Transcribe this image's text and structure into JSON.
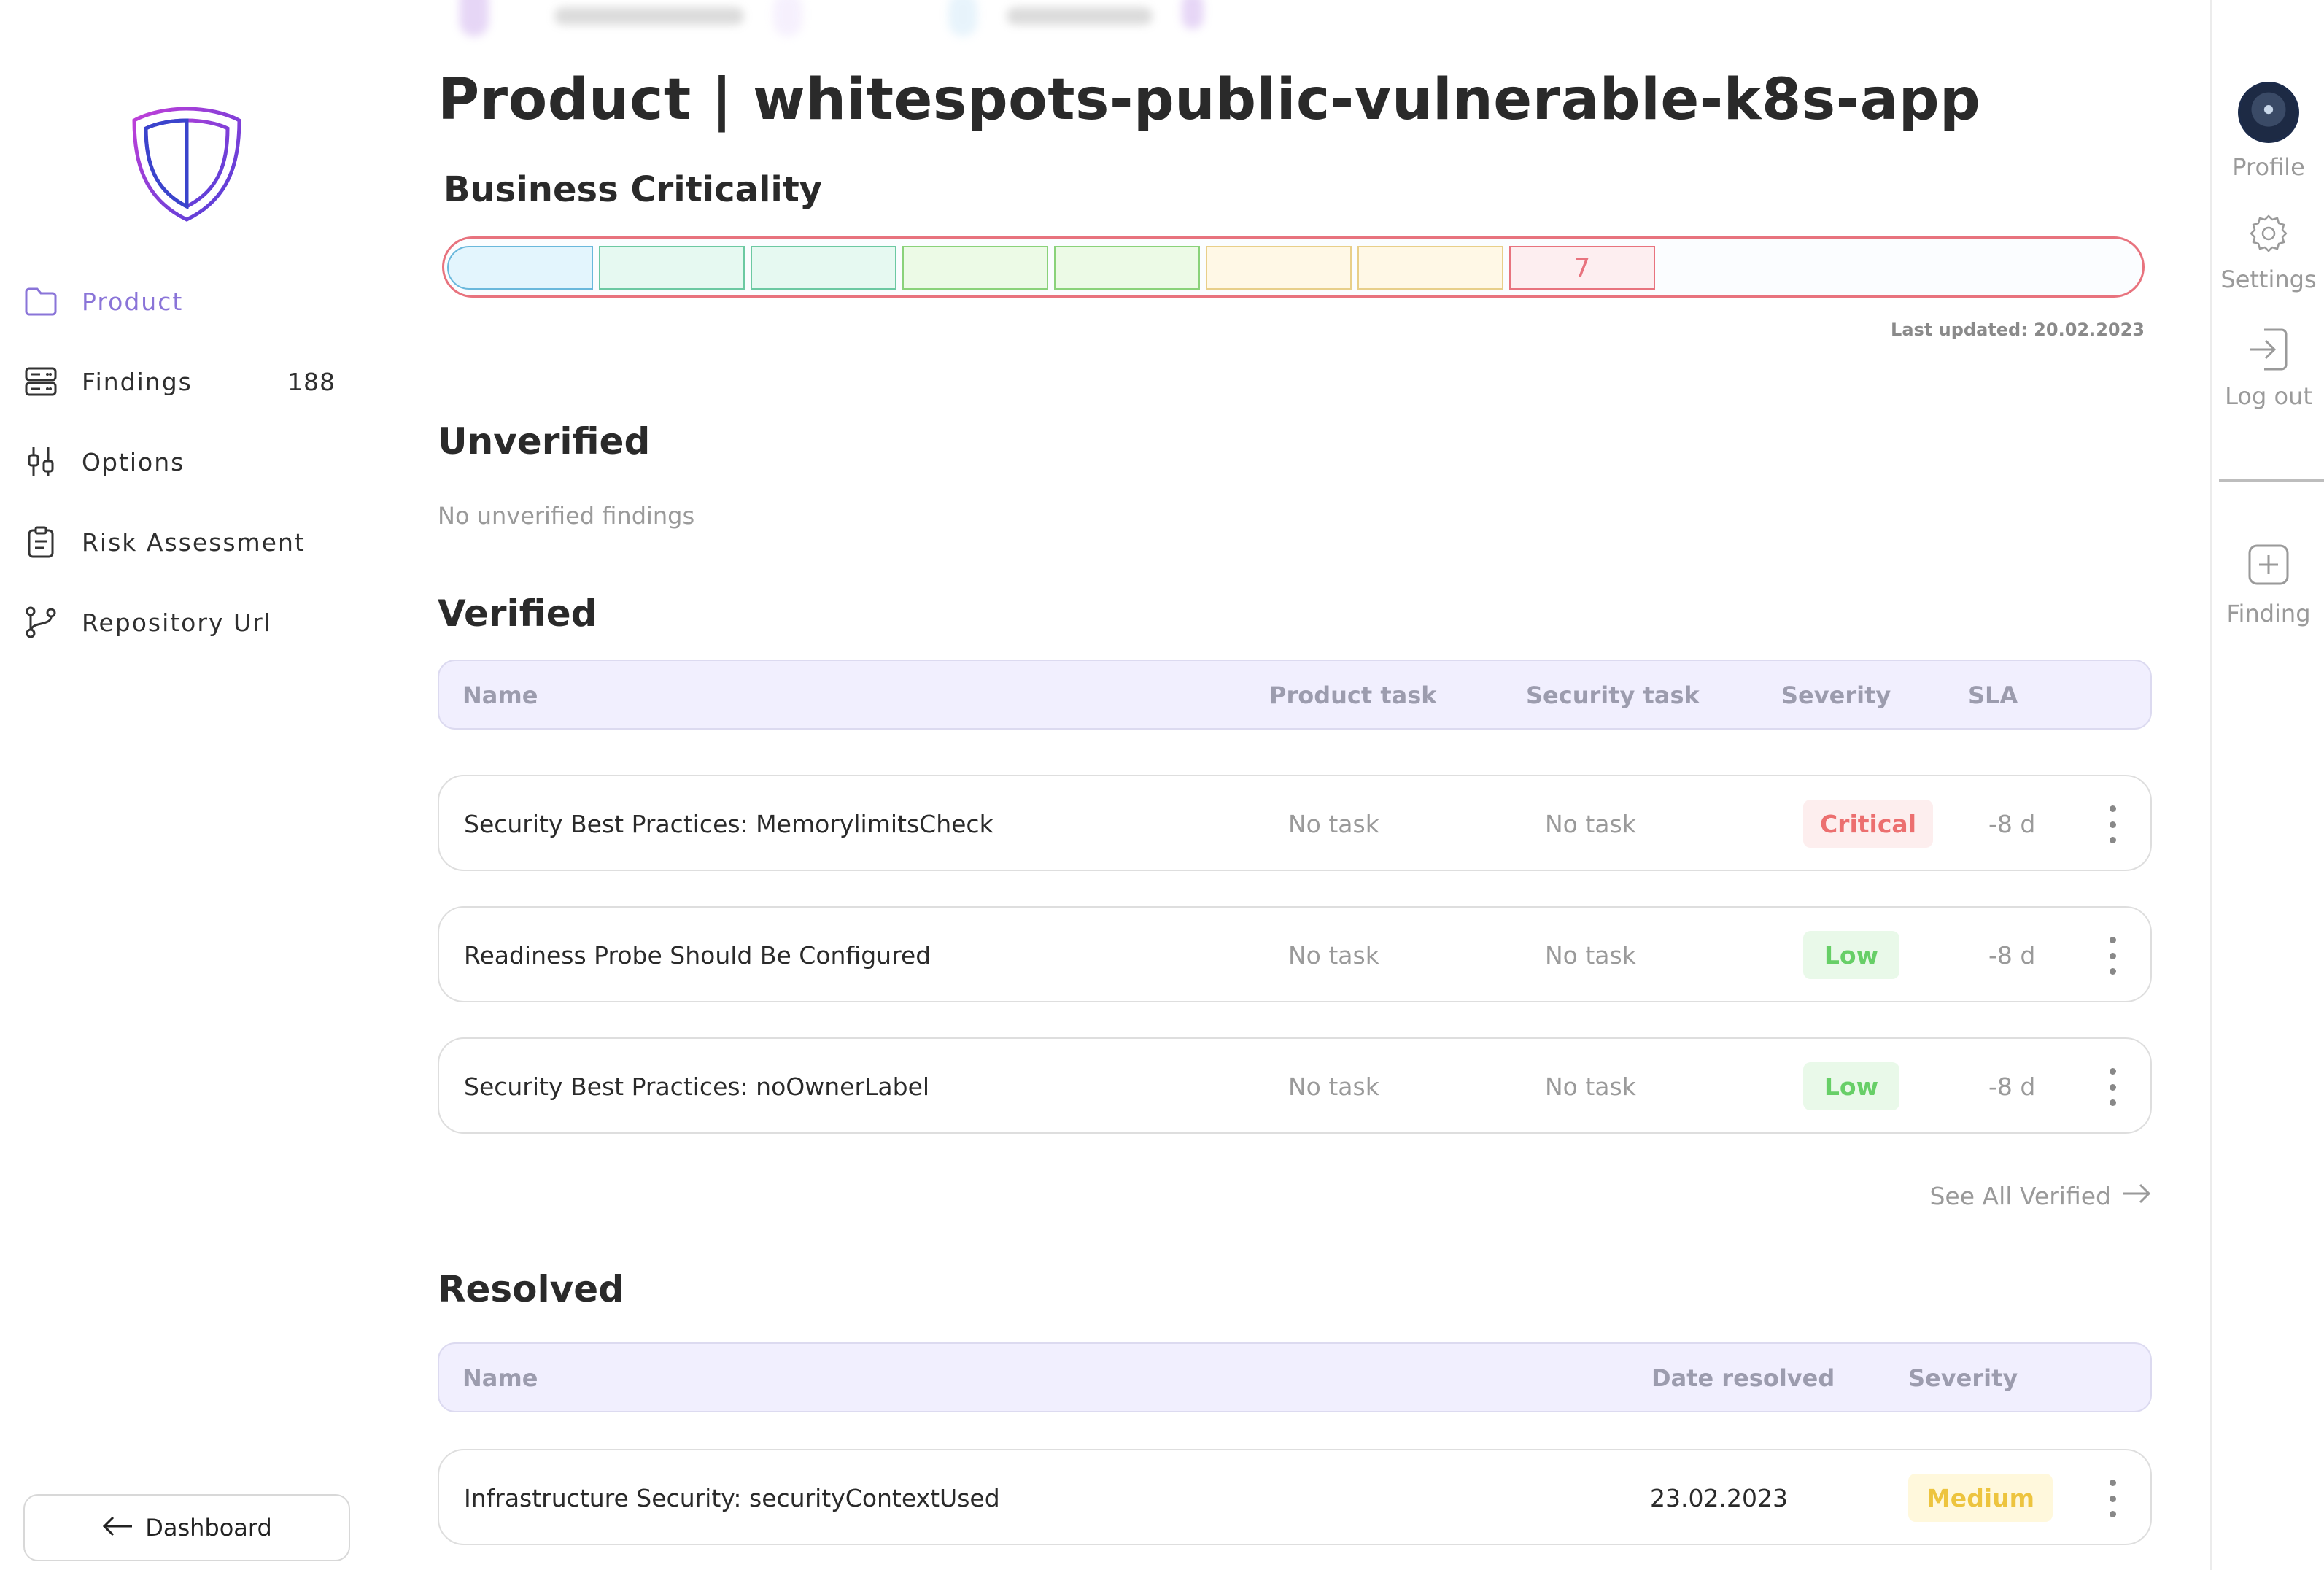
{
  "sidebar": {
    "items": [
      {
        "label": "Product",
        "icon": "folder-icon",
        "active": true
      },
      {
        "label": "Findings",
        "icon": "server-stack-icon",
        "count": "188"
      },
      {
        "label": "Options",
        "icon": "sliders-icon"
      },
      {
        "label": "Risk Assessment",
        "icon": "clipboard-icon"
      },
      {
        "label": "Repository Url",
        "icon": "git-branch-icon"
      }
    ],
    "dashboard_button": "Dashboard"
  },
  "header": {
    "title": "Product | whitespots-public-vulnerable-k8s-app"
  },
  "business_criticality": {
    "title": "Business Criticality",
    "value": "7",
    "last_updated": "Last updated: 20.02.2023"
  },
  "unverified": {
    "title": "Unverified",
    "empty_text": "No unverified findings"
  },
  "verified": {
    "title": "Verified",
    "columns": {
      "name": "Name",
      "product_task": "Product task",
      "security_task": "Security task",
      "severity": "Severity",
      "sla": "SLA"
    },
    "rows": [
      {
        "name": "Security Best Practices: MemorylimitsCheck",
        "product_task": "No task",
        "security_task": "No task",
        "severity": "Critical",
        "sla": "-8 d"
      },
      {
        "name": "Readiness Probe Should Be Configured",
        "product_task": "No task",
        "security_task": "No task",
        "severity": "Low",
        "sla": "-8 d"
      },
      {
        "name": "Security Best Practices: noOwnerLabel",
        "product_task": "No task",
        "security_task": "No task",
        "severity": "Low",
        "sla": "-8 d"
      }
    ],
    "see_all": "See All Verified"
  },
  "resolved": {
    "title": "Resolved",
    "columns": {
      "name": "Name",
      "date_resolved": "Date resolved",
      "severity": "Severity"
    },
    "rows": [
      {
        "name": "Infrastructure Security: securityContextUsed",
        "date_resolved": "23.02.2023",
        "severity": "Medium"
      }
    ]
  },
  "rail": {
    "profile": "Profile",
    "settings": "Settings",
    "logout": "Log out",
    "finding": "Finding"
  },
  "colors": {
    "accent": "#8a74d8",
    "critical": "#ec6f6f",
    "low": "#67cf67",
    "medium": "#edc43e"
  }
}
